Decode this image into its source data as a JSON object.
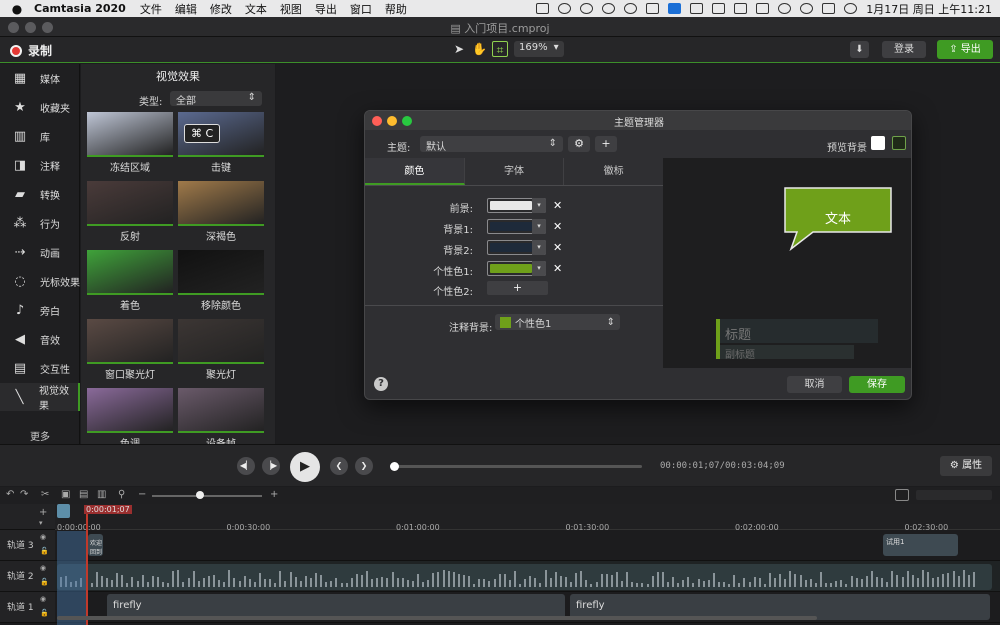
{
  "menubar": {
    "apple": "",
    "app_name": "Camtasia 2020",
    "items": [
      "文件",
      "编辑",
      "修改",
      "文本",
      "视图",
      "导出",
      "窗口",
      "帮助"
    ],
    "clock": "1月17日 周日 上午11:21"
  },
  "window": {
    "title": "入门项目.cmproj"
  },
  "toolbar": {
    "record_label": "录制",
    "zoom": "169%",
    "login_label": "登录",
    "export_label": "导出"
  },
  "sidebar": {
    "items": [
      {
        "label": "媒体",
        "icon": "film-icon",
        "glyph": "▦"
      },
      {
        "label": "收藏夹",
        "icon": "star-icon",
        "glyph": "★"
      },
      {
        "label": "库",
        "icon": "library-icon",
        "glyph": "▥"
      },
      {
        "label": "注释",
        "icon": "annotation-icon",
        "glyph": "◨"
      },
      {
        "label": "转换",
        "icon": "transition-icon",
        "glyph": "▰"
      },
      {
        "label": "行为",
        "icon": "behavior-icon",
        "glyph": "⁂"
      },
      {
        "label": "动画",
        "icon": "animation-icon",
        "glyph": "⇢"
      },
      {
        "label": "光标效果",
        "icon": "cursor-icon",
        "glyph": "◌"
      },
      {
        "label": "旁白",
        "icon": "microphone-icon",
        "glyph": "♪"
      },
      {
        "label": "音效",
        "icon": "speaker-icon",
        "glyph": "◀"
      },
      {
        "label": "交互性",
        "icon": "interactivity-icon",
        "glyph": "▤"
      },
      {
        "label": "视觉效果",
        "icon": "magic-wand-icon",
        "glyph": "╲"
      }
    ],
    "more_label": "更多"
  },
  "effects_panel": {
    "title": "视觉效果",
    "type_label": "类型:",
    "type_value": "全部",
    "thumbnails": [
      {
        "caption": "冻结区域",
        "color": "#bfc6d6"
      },
      {
        "caption": "击键",
        "color": "#5b6a90",
        "badge": "⌘ C"
      },
      {
        "caption": "反射",
        "color": "#4a3b3a"
      },
      {
        "caption": "深褐色",
        "color": "#a07a4a"
      },
      {
        "caption": "着色",
        "color": "#3fa23a"
      },
      {
        "caption": "移除颜色",
        "color": "#111111"
      },
      {
        "caption": "窗口聚光灯",
        "color": "#5a4a44"
      },
      {
        "caption": "聚光灯",
        "color": "#3c3634"
      },
      {
        "caption": "色调",
        "color": "#8a6a9a"
      },
      {
        "caption": "设备帧",
        "color": "#6a5a6a"
      }
    ]
  },
  "theme_dialog": {
    "title": "主题管理器",
    "theme_label": "主题:",
    "theme_value": "默认",
    "gear_glyph": "⚙",
    "add_glyph": "+",
    "preview_bg_label": "预览背景",
    "tabs": [
      "颜色",
      "字体",
      "徽标"
    ],
    "colors": [
      {
        "label": "前景:",
        "value": "#e8e8e8"
      },
      {
        "label": "背景1:",
        "value": "#1e2a3a"
      },
      {
        "label": "背景2:",
        "value": "#1e2a3a"
      },
      {
        "label": "个性色1:",
        "value": "#6fa01a"
      }
    ],
    "accent2_label": "个性色2:",
    "add_color_glyph": "+",
    "annot_bg_label": "注释背景:",
    "annot_bg_value": "个性色1",
    "preview_callout_text": "文本",
    "preview_title": "标题",
    "preview_subtitle": "副标题",
    "help_glyph": "?",
    "cancel_label": "取消",
    "save_label": "保存"
  },
  "playback": {
    "timecode": "00:00:01;07/00:03:04;09",
    "progress": 0.005,
    "properties_label": "属性"
  },
  "timeline": {
    "playhead_time": "0:00:01;07",
    "ruler_ticks": [
      "0:00:00;00",
      "0:00:30;00",
      "0:01:00;00",
      "0:01:30;00",
      "0:02:00;00",
      "0:02:30;00"
    ],
    "tracks": [
      {
        "name": "轨道 3"
      },
      {
        "name": "轨道 2"
      },
      {
        "name": "轨道 1"
      }
    ],
    "clips": {
      "track3_small": "欢迎回到",
      "track3_end": "试用1",
      "track1_a": "firefly",
      "track1_b": "firefly"
    }
  },
  "colors": {
    "accent_green": "#3f9b23",
    "record_red": "#e53935",
    "playhead_red": "#c0392b"
  }
}
